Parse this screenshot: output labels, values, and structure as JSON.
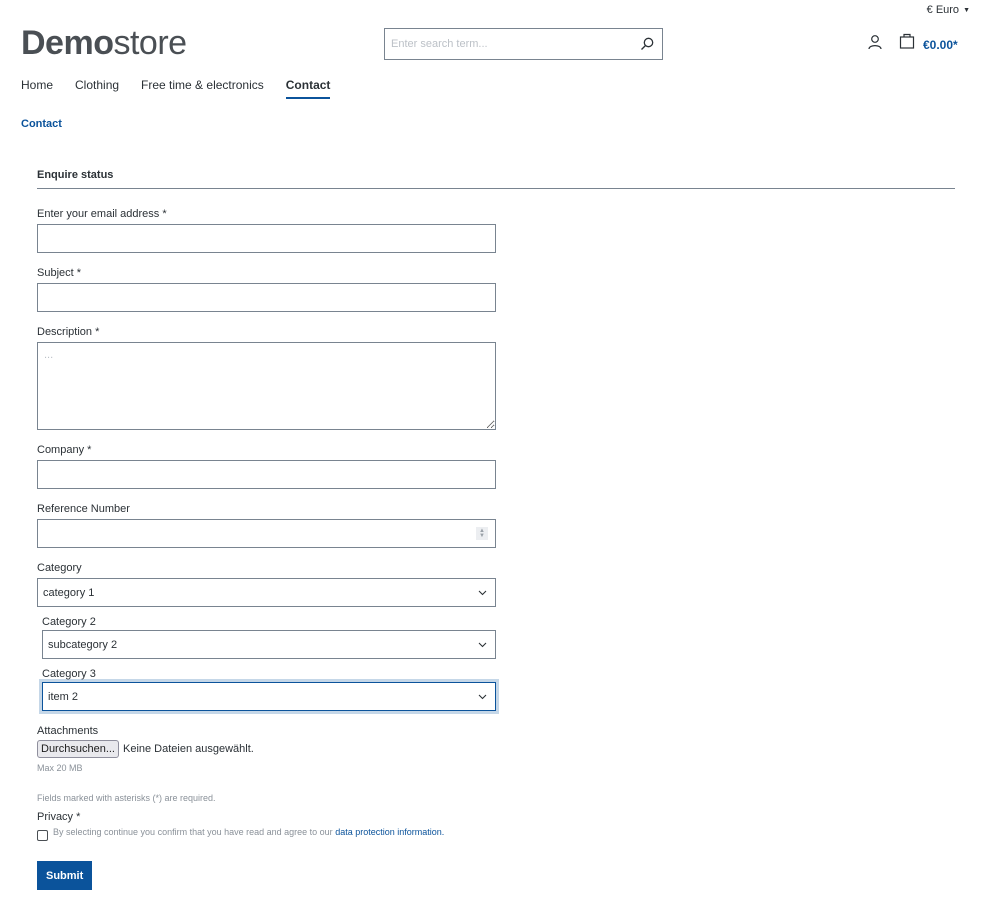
{
  "header": {
    "currency": "€ Euro",
    "logo_bold": "Demo",
    "logo_light": "store",
    "search_placeholder": "Enter search term...",
    "cart_total": "€0.00*"
  },
  "nav": {
    "items": [
      {
        "label": "Home",
        "active": false
      },
      {
        "label": "Clothing",
        "active": false
      },
      {
        "label": "Free time & electronics",
        "active": false
      },
      {
        "label": "Contact",
        "active": true
      }
    ]
  },
  "breadcrumb": "Contact",
  "form": {
    "title": "Enquire status",
    "email_label": "Enter your email address *",
    "email_value": "",
    "subject_label": "Subject *",
    "subject_value": "",
    "description_label": "Description *",
    "description_placeholder": "...",
    "company_label": "Company *",
    "company_value": "",
    "reference_label": "Reference Number",
    "reference_value": "",
    "category_label": "Category",
    "category_value": "category 1",
    "category2_label": "Category 2",
    "category2_value": "subcategory 2",
    "category3_label": "Category 3",
    "category3_value": "item 2",
    "attachments_label": "Attachments",
    "browse_button": "Durchsuchen...",
    "no_file_text": "Keine Dateien ausgewählt.",
    "max_size": "Max 20 MB",
    "required_note": "Fields marked with asterisks (*) are required.",
    "privacy_label": "Privacy *",
    "privacy_text": "By selecting continue you confirm that you have read and agree to our ",
    "privacy_link": "data protection information.",
    "submit_label": "Submit"
  },
  "colors": {
    "accent": "#0b539b",
    "text": "#2b3136",
    "border": "#798490"
  }
}
